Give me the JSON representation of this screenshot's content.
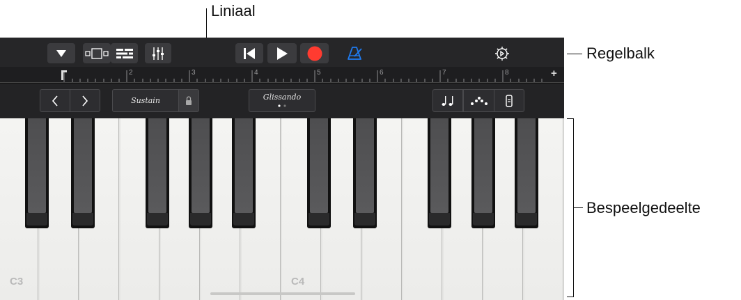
{
  "callouts": {
    "ruler": "Liniaal",
    "control_bar": "Regelbalk",
    "play_area": "Bespeelgedeelte"
  },
  "ruler": {
    "numbers": [
      "2",
      "3",
      "4",
      "5",
      "6",
      "7",
      "8"
    ],
    "add_symbol": "+"
  },
  "toolbar": {
    "sustain_label": "Sustain",
    "glissando_label": "Glissando"
  },
  "keyboard": {
    "note_labels": [
      "C3",
      "C4"
    ]
  },
  "colors": {
    "record": "#ff3b30",
    "metronome": "#1f7cf2",
    "control_bg": "#262628"
  },
  "icons": [
    "dropdown-triangle-icon",
    "view-toggle-icon",
    "tracks-view-icon",
    "mixer-icon",
    "go-to-start-icon",
    "play-icon",
    "record-icon",
    "metronome-icon",
    "settings-gear-icon",
    "chevron-left-icon",
    "chevron-right-icon",
    "lock-icon",
    "notes-icon",
    "arpeggiator-icon",
    "scroll-keys-icon"
  ]
}
